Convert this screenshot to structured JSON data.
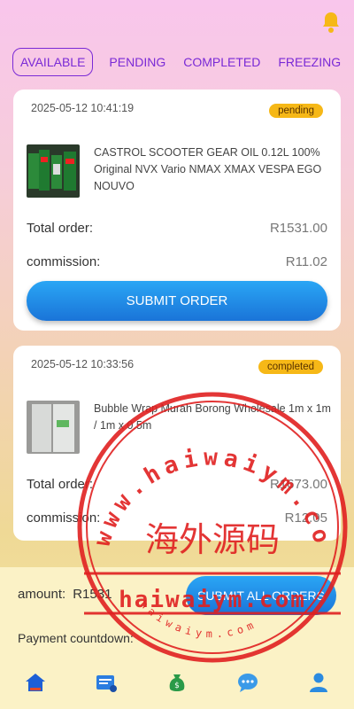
{
  "header": {
    "bell_icon": "bell-icon"
  },
  "tabs": [
    {
      "label": "AVAILABLE",
      "active": true
    },
    {
      "label": "PENDING",
      "active": false
    },
    {
      "label": "COMPLETED",
      "active": false
    },
    {
      "label": "FREEZING",
      "active": false
    }
  ],
  "orders": [
    {
      "time": "2025-05-12 10:41:19",
      "status": "pending",
      "product_name": "CASTROL SCOOTER GEAR OIL 0.12L 100% Original NVX Vario NMAX XMAX VESPA EGO NOUVO",
      "total_label": "Total order:",
      "total_value": "R1531.00",
      "commission_label": "commission:",
      "commission_value": "R11.02",
      "submit_label": "SUBMIT ORDER"
    },
    {
      "time": "2025-05-12 10:33:56",
      "status": "completed",
      "product_name": "Bubble Wrap Murah Borong Wholesale 1m x 1m / 1m x 0.5m",
      "total_label": "Total order:",
      "total_value": "R1673.00",
      "commission_label": "commission:",
      "commission_value": "R12.05"
    }
  ],
  "footer": {
    "amount_label": "amount:",
    "amount_value": "R1531",
    "submit_all_label": "SUBMIT ALL ORDERS",
    "countdown_label": "Payment countdown:"
  },
  "watermark": {
    "top_text": "www.haiwaiym.com",
    "center_text": "海外源码",
    "band_text": "haiwaiym.com",
    "bottom_text": "haiwaiym.com"
  },
  "nav": [
    "home-icon",
    "orders-icon",
    "money-bag-icon",
    "chat-icon",
    "profile-icon"
  ],
  "colors": {
    "accent": "#7a2ad6",
    "button": "#1a8ae8",
    "badge": "#f6b817",
    "watermark": "#e02020"
  }
}
